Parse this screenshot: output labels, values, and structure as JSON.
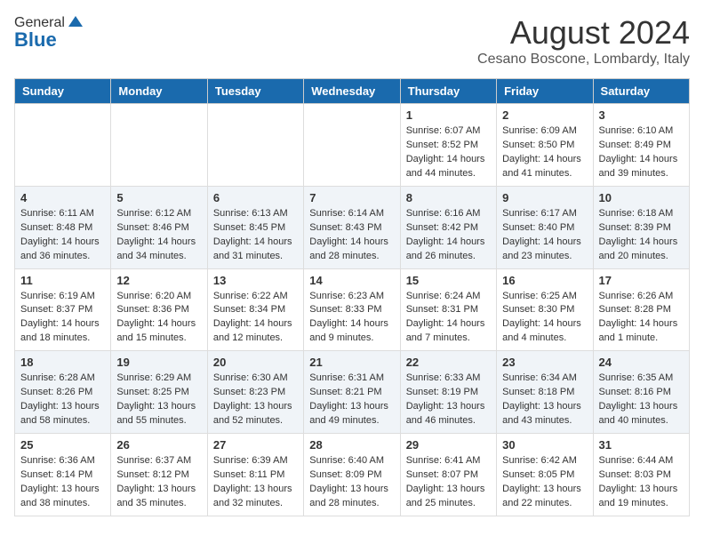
{
  "header": {
    "logo_general": "General",
    "logo_blue": "Blue",
    "month_title": "August 2024",
    "location": "Cesano Boscone, Lombardy, Italy"
  },
  "weekdays": [
    "Sunday",
    "Monday",
    "Tuesday",
    "Wednesday",
    "Thursday",
    "Friday",
    "Saturday"
  ],
  "weeks": [
    [
      {
        "day": "",
        "info": ""
      },
      {
        "day": "",
        "info": ""
      },
      {
        "day": "",
        "info": ""
      },
      {
        "day": "",
        "info": ""
      },
      {
        "day": "1",
        "info": "Sunrise: 6:07 AM\nSunset: 8:52 PM\nDaylight: 14 hours\nand 44 minutes."
      },
      {
        "day": "2",
        "info": "Sunrise: 6:09 AM\nSunset: 8:50 PM\nDaylight: 14 hours\nand 41 minutes."
      },
      {
        "day": "3",
        "info": "Sunrise: 6:10 AM\nSunset: 8:49 PM\nDaylight: 14 hours\nand 39 minutes."
      }
    ],
    [
      {
        "day": "4",
        "info": "Sunrise: 6:11 AM\nSunset: 8:48 PM\nDaylight: 14 hours\nand 36 minutes."
      },
      {
        "day": "5",
        "info": "Sunrise: 6:12 AM\nSunset: 8:46 PM\nDaylight: 14 hours\nand 34 minutes."
      },
      {
        "day": "6",
        "info": "Sunrise: 6:13 AM\nSunset: 8:45 PM\nDaylight: 14 hours\nand 31 minutes."
      },
      {
        "day": "7",
        "info": "Sunrise: 6:14 AM\nSunset: 8:43 PM\nDaylight: 14 hours\nand 28 minutes."
      },
      {
        "day": "8",
        "info": "Sunrise: 6:16 AM\nSunset: 8:42 PM\nDaylight: 14 hours\nand 26 minutes."
      },
      {
        "day": "9",
        "info": "Sunrise: 6:17 AM\nSunset: 8:40 PM\nDaylight: 14 hours\nand 23 minutes."
      },
      {
        "day": "10",
        "info": "Sunrise: 6:18 AM\nSunset: 8:39 PM\nDaylight: 14 hours\nand 20 minutes."
      }
    ],
    [
      {
        "day": "11",
        "info": "Sunrise: 6:19 AM\nSunset: 8:37 PM\nDaylight: 14 hours\nand 18 minutes."
      },
      {
        "day": "12",
        "info": "Sunrise: 6:20 AM\nSunset: 8:36 PM\nDaylight: 14 hours\nand 15 minutes."
      },
      {
        "day": "13",
        "info": "Sunrise: 6:22 AM\nSunset: 8:34 PM\nDaylight: 14 hours\nand 12 minutes."
      },
      {
        "day": "14",
        "info": "Sunrise: 6:23 AM\nSunset: 8:33 PM\nDaylight: 14 hours\nand 9 minutes."
      },
      {
        "day": "15",
        "info": "Sunrise: 6:24 AM\nSunset: 8:31 PM\nDaylight: 14 hours\nand 7 minutes."
      },
      {
        "day": "16",
        "info": "Sunrise: 6:25 AM\nSunset: 8:30 PM\nDaylight: 14 hours\nand 4 minutes."
      },
      {
        "day": "17",
        "info": "Sunrise: 6:26 AM\nSunset: 8:28 PM\nDaylight: 14 hours\nand 1 minute."
      }
    ],
    [
      {
        "day": "18",
        "info": "Sunrise: 6:28 AM\nSunset: 8:26 PM\nDaylight: 13 hours\nand 58 minutes."
      },
      {
        "day": "19",
        "info": "Sunrise: 6:29 AM\nSunset: 8:25 PM\nDaylight: 13 hours\nand 55 minutes."
      },
      {
        "day": "20",
        "info": "Sunrise: 6:30 AM\nSunset: 8:23 PM\nDaylight: 13 hours\nand 52 minutes."
      },
      {
        "day": "21",
        "info": "Sunrise: 6:31 AM\nSunset: 8:21 PM\nDaylight: 13 hours\nand 49 minutes."
      },
      {
        "day": "22",
        "info": "Sunrise: 6:33 AM\nSunset: 8:19 PM\nDaylight: 13 hours\nand 46 minutes."
      },
      {
        "day": "23",
        "info": "Sunrise: 6:34 AM\nSunset: 8:18 PM\nDaylight: 13 hours\nand 43 minutes."
      },
      {
        "day": "24",
        "info": "Sunrise: 6:35 AM\nSunset: 8:16 PM\nDaylight: 13 hours\nand 40 minutes."
      }
    ],
    [
      {
        "day": "25",
        "info": "Sunrise: 6:36 AM\nSunset: 8:14 PM\nDaylight: 13 hours\nand 38 minutes."
      },
      {
        "day": "26",
        "info": "Sunrise: 6:37 AM\nSunset: 8:12 PM\nDaylight: 13 hours\nand 35 minutes."
      },
      {
        "day": "27",
        "info": "Sunrise: 6:39 AM\nSunset: 8:11 PM\nDaylight: 13 hours\nand 32 minutes."
      },
      {
        "day": "28",
        "info": "Sunrise: 6:40 AM\nSunset: 8:09 PM\nDaylight: 13 hours\nand 28 minutes."
      },
      {
        "day": "29",
        "info": "Sunrise: 6:41 AM\nSunset: 8:07 PM\nDaylight: 13 hours\nand 25 minutes."
      },
      {
        "day": "30",
        "info": "Sunrise: 6:42 AM\nSunset: 8:05 PM\nDaylight: 13 hours\nand 22 minutes."
      },
      {
        "day": "31",
        "info": "Sunrise: 6:44 AM\nSunset: 8:03 PM\nDaylight: 13 hours\nand 19 minutes."
      }
    ]
  ]
}
